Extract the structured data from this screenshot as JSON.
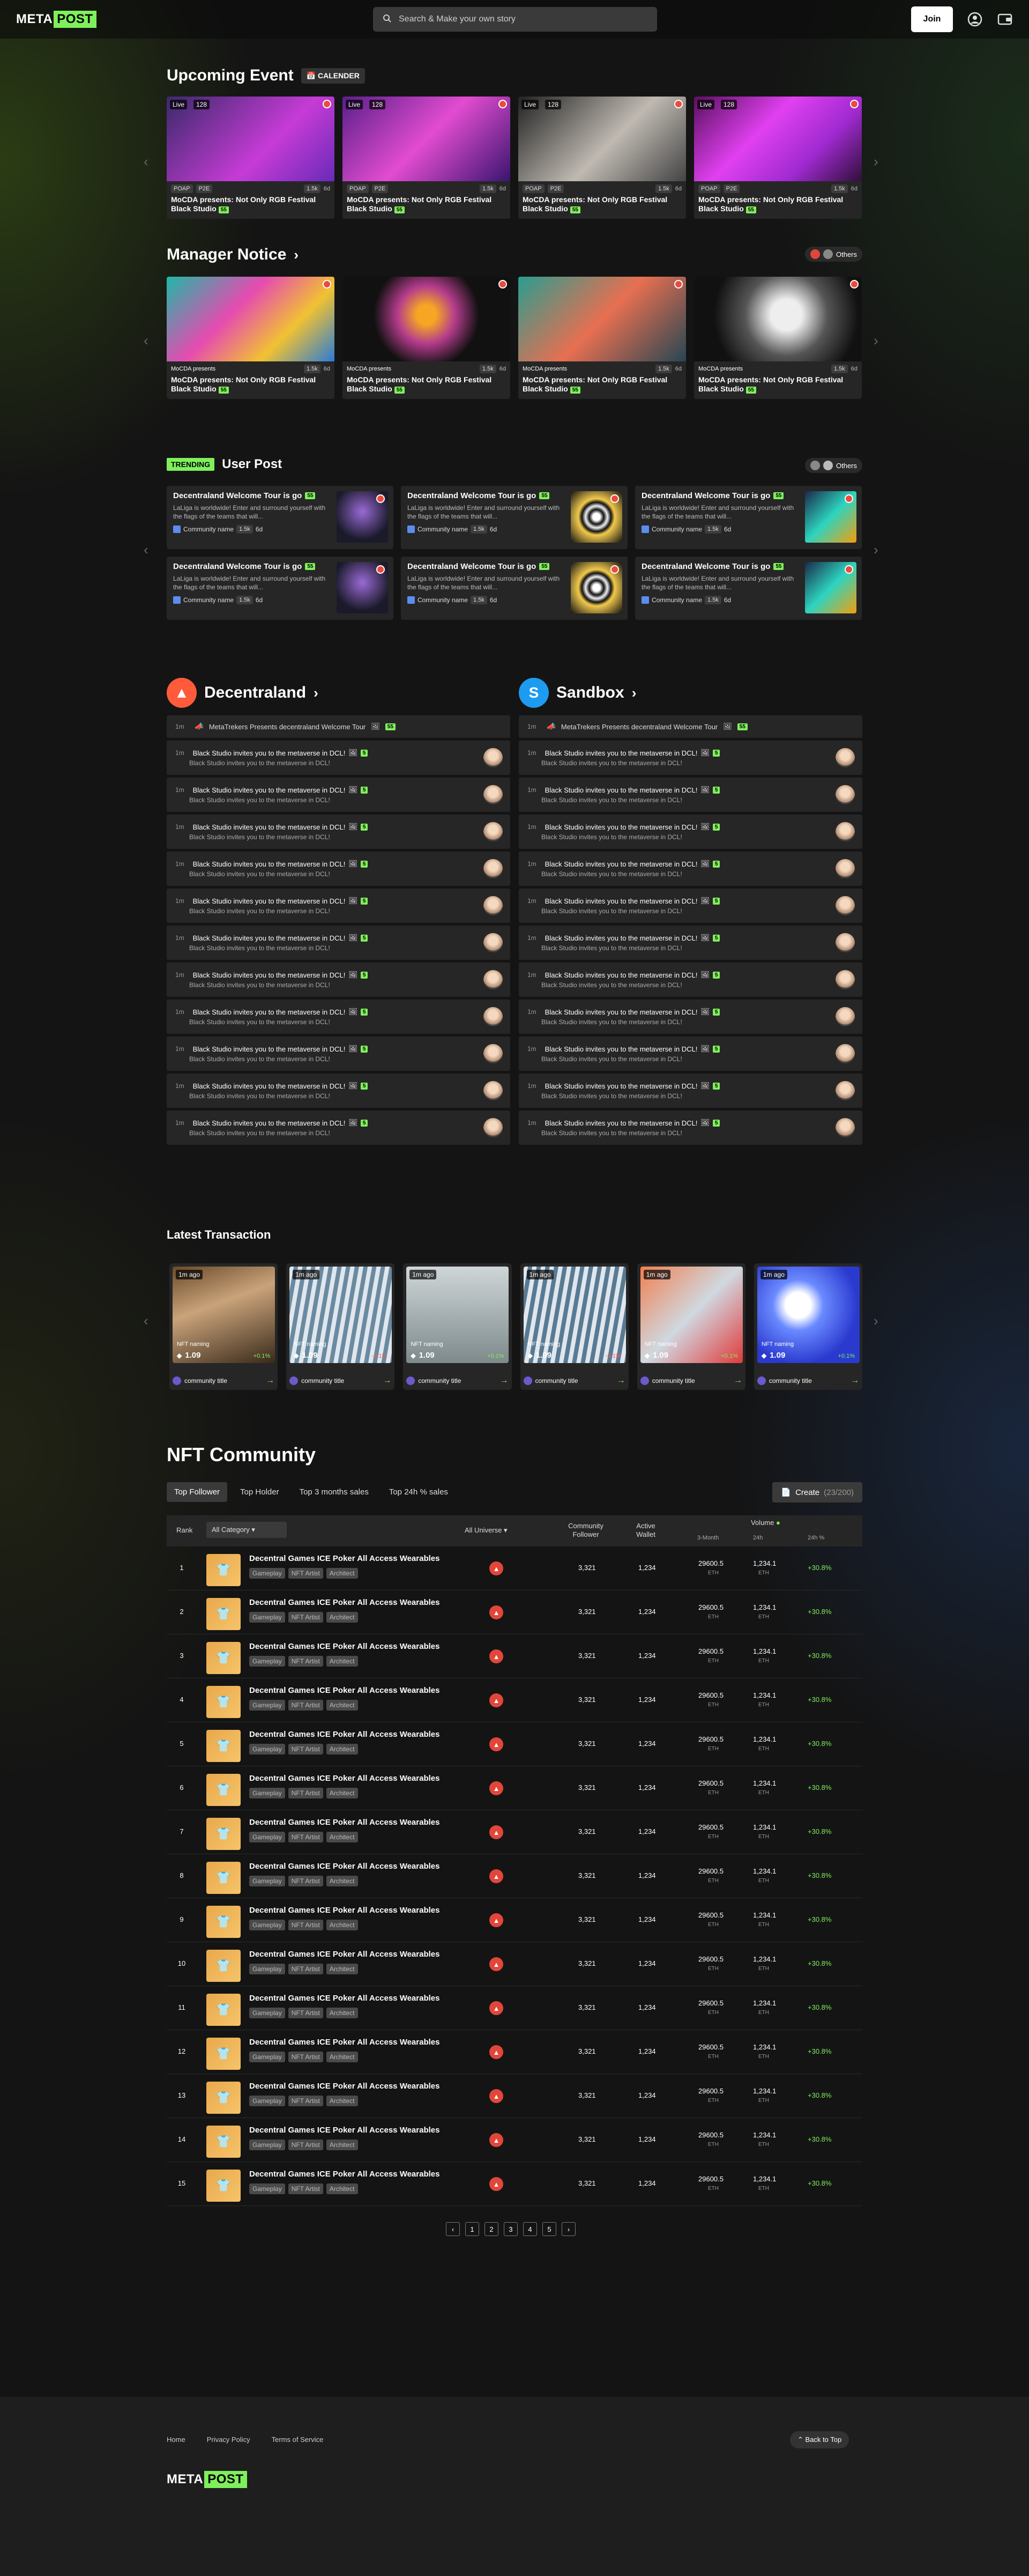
{
  "header": {
    "logo_a": "META",
    "logo_b": "POST",
    "search_placeholder": "Search & Make your own story",
    "join": "Join"
  },
  "upcoming": {
    "title": "Upcoming Event",
    "calendar": "CALENDER",
    "live": "Live",
    "count": "128",
    "poap": "POAP",
    "p2e": "P2E",
    "views": "1.5k",
    "time": "6d",
    "titleline": "MoCDA presents: Not Only RGB Festival Black Studio",
    "score": "55"
  },
  "manager": {
    "title": "Manager Notice",
    "others": "Others",
    "presents": "MoCDA presents",
    "views": "1.5k",
    "time": "6d",
    "titleline": "MoCDA presents: Not Only RGB Festival Black Studio",
    "score": "55"
  },
  "userpost": {
    "trending": "TRENDING",
    "title": "User Post",
    "others": "Others",
    "card_title": "Decentraland Welcome Tour is go",
    "score": "55",
    "desc": "LaLiga is worldwide! Enter and surround yourself with the flags of the teams that will...",
    "community": "Community name",
    "views": "1.5k",
    "time": "6d"
  },
  "decentraland": {
    "title": "Decentraland",
    "first_time": "1m",
    "first": "MetaTrekers Presents decentraland Welcome Tour",
    "first_score": "55",
    "time": "1m",
    "line1": "Black Studio invites you to the metaverse in DCL!",
    "line2": "Black Studio invites you to the metaverse in DCL!",
    "badge": "5"
  },
  "sandbox": {
    "title": "Sandbox",
    "first_time": "1m",
    "first": "MetaTrekers Presents decentraland Welcome Tour",
    "first_score": "55",
    "time": "1m",
    "line1": "Black Studio invites you to the metaverse in DCL!",
    "line2": "Black Studio invites you to the metaverse in DCL!",
    "badge": "5"
  },
  "transaction": {
    "title": "Latest Transaction",
    "ago": "1m ago",
    "naming": "NFT naming",
    "value": "1.09",
    "community": "community title",
    "cards": [
      {
        "pct": "+0.1%"
      },
      {
        "pct": "-0.1%"
      },
      {
        "pct": "+0.1%"
      },
      {
        "pct": "-0.1%"
      },
      {
        "pct": "+0.1%"
      },
      {
        "pct": "+0.1%"
      }
    ]
  },
  "nft": {
    "title": "NFT Community",
    "tabs": [
      "Top Follower",
      "Top Holder",
      "Top 3 months sales",
      "Top 24h % sales"
    ],
    "create": "Create",
    "create_count": "(23/200)",
    "col_rank": "Rank",
    "col_category": "All Category",
    "col_universe": "All Universe",
    "col_follower": "Community Follower",
    "col_wallet": "Active Wallet",
    "col_volume": "Volume",
    "col_3m": "3-Month",
    "col_24h": "24h",
    "col_pct": "24h %",
    "row_name": "Decentral Games ICE Poker All Access Wearables",
    "tags": [
      "Gameplay",
      "NFT Artist",
      "Architect"
    ],
    "follower": "3,321",
    "wallet": "1,234",
    "v3m": "29600.5",
    "v24h": "1,234.1",
    "eth": "ETH",
    "pct": "+30.8%",
    "ranks": [
      "1",
      "2",
      "3",
      "4",
      "5",
      "6",
      "7",
      "8",
      "9",
      "10",
      "11",
      "12",
      "13",
      "14",
      "15"
    ],
    "pages": [
      "‹",
      "1",
      "2",
      "3",
      "4",
      "5",
      "›"
    ]
  },
  "footer": {
    "home": "Home",
    "privacy": "Privacy Policy",
    "terms": "Terms of Service",
    "back": "Back to Top",
    "logo_a": "META",
    "logo_b": "POST"
  }
}
